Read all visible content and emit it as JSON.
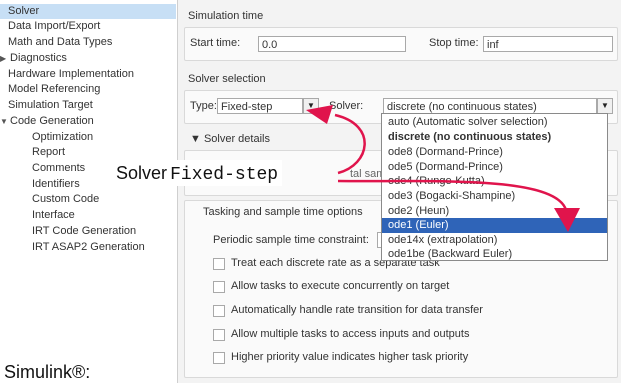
{
  "nav": {
    "items": [
      {
        "label": "Solver",
        "expander": "",
        "selected": true
      },
      {
        "label": "Data Import/Export",
        "expander": ""
      },
      {
        "label": "Math and Data Types",
        "expander": ""
      },
      {
        "label": "Diagnostics",
        "expander": "▶"
      },
      {
        "label": "Hardware Implementation",
        "expander": ""
      },
      {
        "label": "Model Referencing",
        "expander": ""
      },
      {
        "label": "Simulation Target",
        "expander": ""
      },
      {
        "label": "Code Generation",
        "expander": "▼"
      },
      {
        "label": "Optimization",
        "expander": ""
      },
      {
        "label": "Report",
        "expander": ""
      },
      {
        "label": "Comments",
        "expander": ""
      },
      {
        "label": "Identifiers",
        "expander": ""
      },
      {
        "label": "Custom Code",
        "expander": ""
      },
      {
        "label": "Interface",
        "expander": ""
      },
      {
        "label": "IRT Code Generation",
        "expander": ""
      },
      {
        "label": "IRT ASAP2 Generation",
        "expander": ""
      }
    ]
  },
  "sim_time": {
    "title": "Simulation time",
    "start_label": "Start time:",
    "start_value": "0.0",
    "stop_label": "Stop time:",
    "stop_value": "inf"
  },
  "solver_selection": {
    "title": "Solver selection",
    "type_label": "Type:",
    "type_value": "Fixed-step",
    "solver_label": "Solver:",
    "solver_value": "discrete (no continuous states)"
  },
  "solver_details": {
    "title": "▼ Solver details",
    "partial_label": "tal sam"
  },
  "tasking": {
    "title": "Tasking and sample time options",
    "periodic_label": "Periodic sample time constraint:",
    "checkboxes": [
      "Treat each discrete rate as a separate task",
      "Allow tasks to execute concurrently on target",
      "Automatically handle rate transition for data transfer",
      "Allow multiple tasks to access inputs and outputs",
      "Higher priority value indicates higher task priority"
    ]
  },
  "solver_options": [
    {
      "label": "auto (Automatic solver selection)"
    },
    {
      "label": "discrete (no continuous states)",
      "bold": true
    },
    {
      "label": "ode8 (Dormand-Prince)"
    },
    {
      "label": "ode5 (Dormand-Prince)"
    },
    {
      "label": "ode4 (Runge-Kutta)"
    },
    {
      "label": "ode3 (Bogacki-Shampine)"
    },
    {
      "label": "ode2 (Heun)"
    },
    {
      "label": "ode1 (Euler)",
      "highlighted": true
    },
    {
      "label": "ode14x (extrapolation)"
    },
    {
      "label": "ode1be (Backward Euler)"
    }
  ],
  "annotation": {
    "word": "Solver",
    "code": "Fixed-step",
    "arrow_color": "#e0144c"
  },
  "brand": "Simulink®:",
  "colors": {
    "selection": "#c7dff5",
    "highlight": "#2f64b8"
  }
}
